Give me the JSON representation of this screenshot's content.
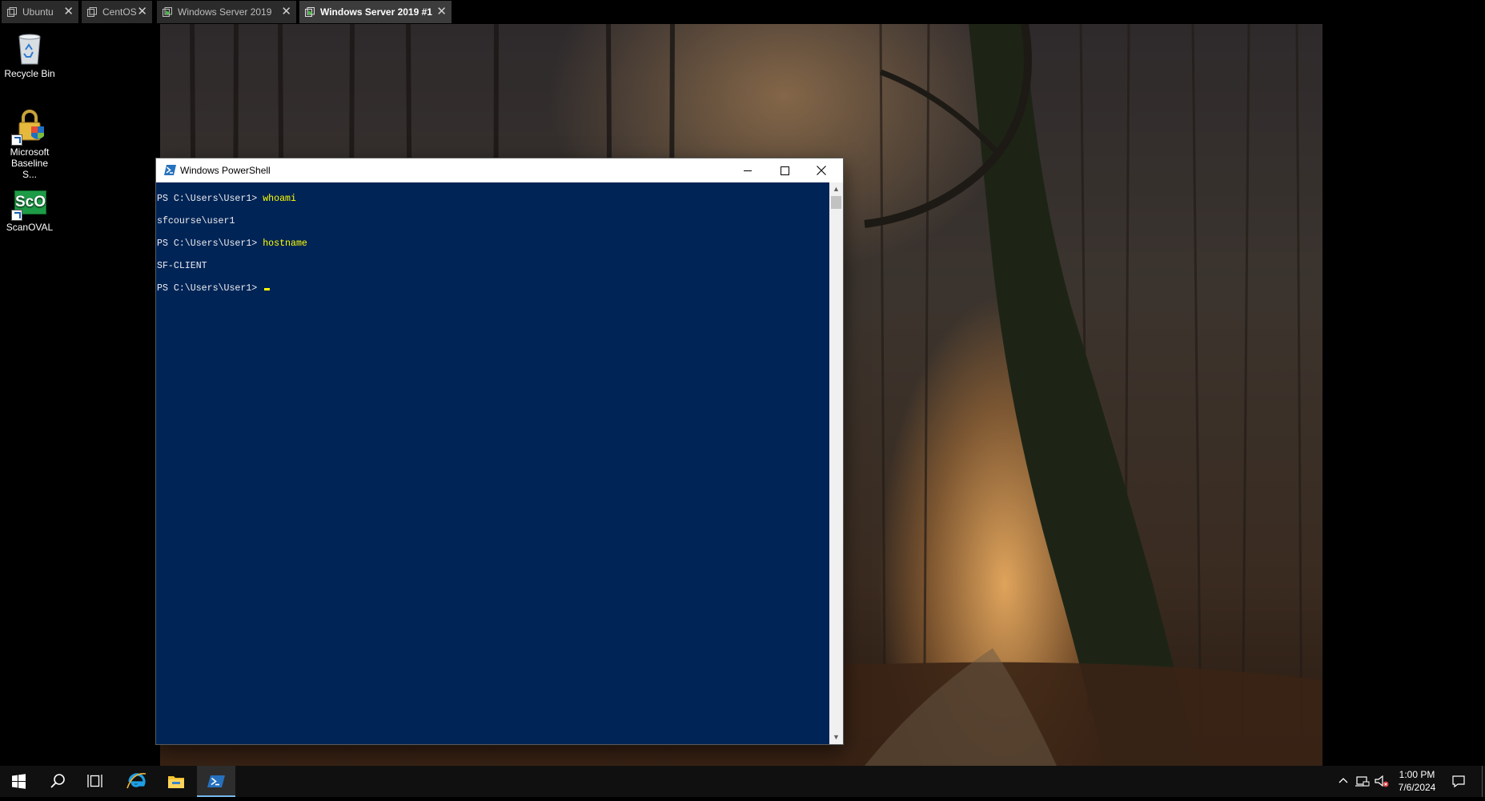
{
  "vm_tabs": [
    {
      "label": "Ubuntu",
      "active": false
    },
    {
      "label": "CentOS",
      "active": false
    },
    {
      "label": "Windows Server 2019",
      "active": false
    },
    {
      "label": "Windows Server 2019 #1",
      "active": true
    }
  ],
  "tab_close_glyph": "✕",
  "desktop_icons": [
    {
      "label": "Recycle Bin",
      "icon": "recycle-bin-icon"
    },
    {
      "label": "Microsoft Baseline S...",
      "icon": "microsoft-baseline-security-analyzer-icon"
    },
    {
      "label": "ScanOVAL",
      "icon": "scanoval-icon",
      "badge": "ScO"
    }
  ],
  "powershell": {
    "title": "Windows PowerShell",
    "lines": [
      {
        "prompt": "PS C:\\Users\\User1> ",
        "command": "whoami"
      },
      {
        "output": "sfcourse\\user1"
      },
      {
        "prompt": "PS C:\\Users\\User1> ",
        "command": "hostname"
      },
      {
        "output": "SF-CLIENT"
      },
      {
        "prompt": "PS C:\\Users\\User1> ",
        "command": "",
        "cursor": true
      }
    ],
    "colors": {
      "background": "#012456",
      "text": "#eeedf0",
      "command": "#ffff00"
    }
  },
  "taskbar": {
    "items": [
      "start-icon",
      "search-icon",
      "task-view-icon",
      "internet-explorer-icon",
      "file-explorer-icon",
      "powershell-icon"
    ],
    "active_item": "powershell-icon",
    "tray": [
      "show-hidden-icons-icon",
      "network-icon",
      "volume-muted-icon"
    ],
    "time": "1:00 PM",
    "date": "7/6/2024",
    "notification_icon": "action-center-icon"
  }
}
